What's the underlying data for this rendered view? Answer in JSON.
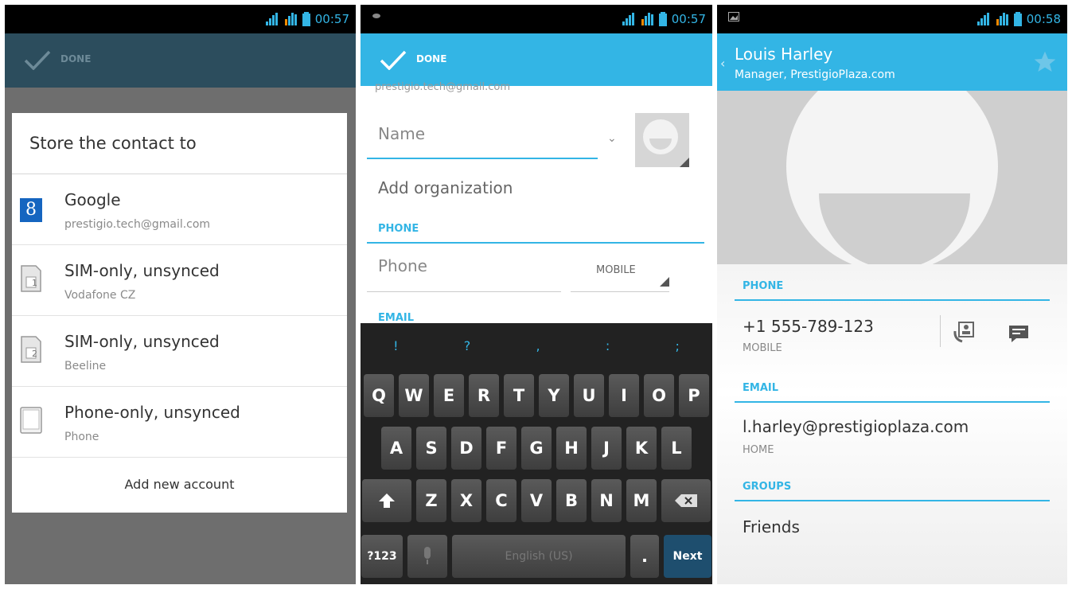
{
  "status": {
    "time_1": "00:57",
    "time_2": "00:57",
    "time_3": "00:58"
  },
  "screen1": {
    "done_label": "DONE",
    "dialog_title": "Store the contact to",
    "accounts": [
      {
        "name": "Google",
        "sub": "prestigio.tech@gmail.com",
        "icon": "google-icon"
      },
      {
        "name": "SIM-only, unsynced",
        "sub": "Vodafone CZ",
        "icon": "sim-1-icon"
      },
      {
        "name": "SIM-only, unsynced",
        "sub": "Beeline",
        "icon": "sim-2-icon"
      },
      {
        "name": "Phone-only, unsynced",
        "sub": "Phone",
        "icon": "phone-device-icon"
      }
    ],
    "add_account": "Add new account",
    "google_glyph": "8",
    "sim1_glyph": "1",
    "sim2_glyph": "2"
  },
  "screen2": {
    "done_label": "DONE",
    "account_cut": "prestigio.tech@gmail.com",
    "name_placeholder": "Name",
    "add_organization": "Add organization",
    "phone_section": "PHONE",
    "phone_placeholder": "Phone",
    "phone_type": "MOBILE",
    "email_section": "EMAIL",
    "keyboard": {
      "symbols": [
        "!",
        "?",
        ",",
        ":",
        ";"
      ],
      "row1": [
        "Q",
        "W",
        "E",
        "R",
        "T",
        "Y",
        "U",
        "I",
        "O",
        "P"
      ],
      "row2": [
        "A",
        "S",
        "D",
        "F",
        "G",
        "H",
        "J",
        "K",
        "L"
      ],
      "row3": [
        "Z",
        "X",
        "C",
        "V",
        "B",
        "N",
        "M"
      ],
      "numbers_key": "?123",
      "space_key": "English (US)",
      "period_key": ".",
      "next_key": "Next"
    }
  },
  "screen3": {
    "contact_name": "Louis Harley",
    "contact_title": "Manager, PrestigioPlaza.com",
    "phone_section": "PHONE",
    "phone_number": "+1 555-789-123",
    "phone_type": "MOBILE",
    "email_section": "EMAIL",
    "email": "l.harley@prestigioplaza.com",
    "email_type": "HOME",
    "groups_section": "GROUPS",
    "group": "Friends"
  },
  "colors": {
    "accent": "#33b5e5",
    "action_dark": "#2c4d5d",
    "keyboard": "#222222"
  }
}
